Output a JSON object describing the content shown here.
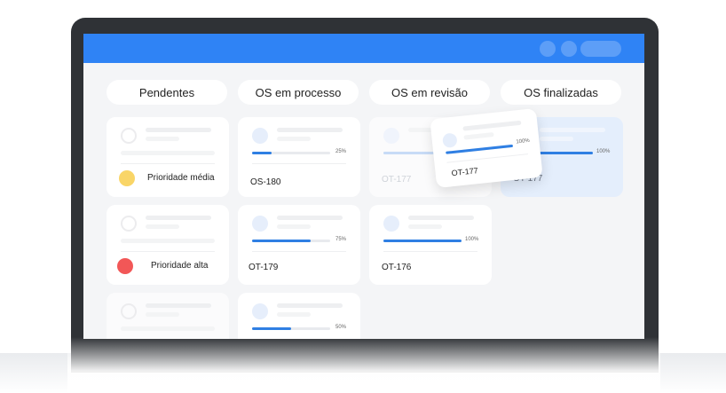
{
  "columns": [
    {
      "label": "Pendentes"
    },
    {
      "label": "OS em processo"
    },
    {
      "label": "OS em revisão"
    },
    {
      "label": "OS finalizadas"
    }
  ],
  "pending_cards": [
    {
      "priority_label": "Prioridade média",
      "priority_color": "#f9d567"
    },
    {
      "priority_label": "Prioridade alta",
      "priority_color": "#f25757"
    }
  ],
  "process_cards": [
    {
      "code": "OS-180",
      "progress": 25,
      "progress_label": "25%"
    },
    {
      "code": "OT-179",
      "progress": 75,
      "progress_label": "75%"
    },
    {
      "progress": 50,
      "progress_label": "50%"
    }
  ],
  "review_cards": [
    {
      "code": "OT-177"
    },
    {
      "code": "OT-176",
      "progress": 100,
      "progress_label": "100%"
    }
  ],
  "dragged_card": {
    "code": "OT-177",
    "progress": 100,
    "progress_label": "100%"
  },
  "final_cards": [
    {
      "code": "OT-177",
      "progress": 100,
      "progress_label": "100%"
    }
  ],
  "colors": {
    "accent": "#2f83f5",
    "progress": "#2f7fe3"
  }
}
